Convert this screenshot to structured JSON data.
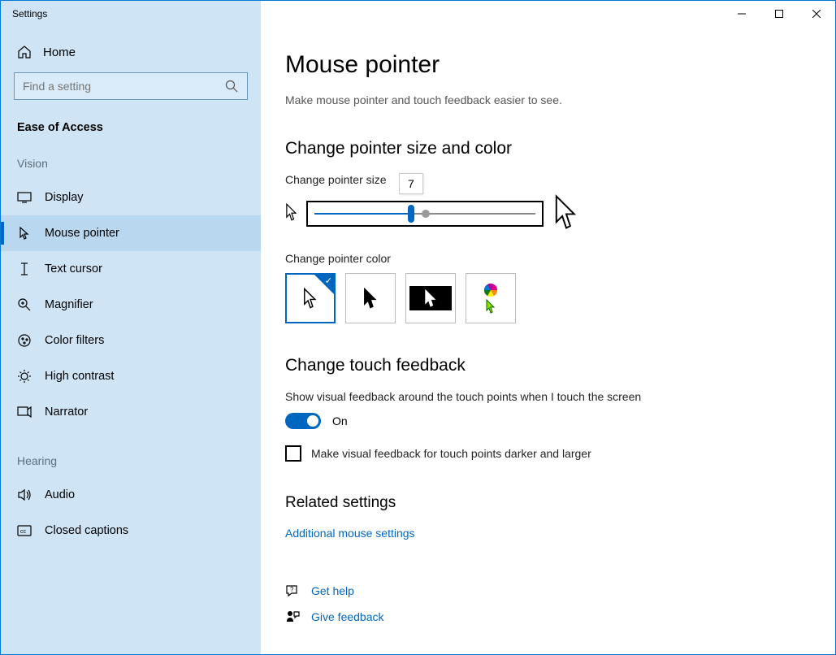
{
  "window": {
    "title": "Settings"
  },
  "sidebar": {
    "home": "Home",
    "search_placeholder": "Find a setting",
    "section": "Ease of Access",
    "groups": [
      {
        "label": "Vision",
        "items": [
          {
            "icon": "display-icon",
            "label": "Display"
          },
          {
            "icon": "mouse-pointer-icon",
            "label": "Mouse pointer",
            "active": true
          },
          {
            "icon": "text-cursor-icon",
            "label": "Text cursor"
          },
          {
            "icon": "magnifier-icon",
            "label": "Magnifier"
          },
          {
            "icon": "color-filters-icon",
            "label": "Color filters"
          },
          {
            "icon": "high-contrast-icon",
            "label": "High contrast"
          },
          {
            "icon": "narrator-icon",
            "label": "Narrator"
          }
        ]
      },
      {
        "label": "Hearing",
        "items": [
          {
            "icon": "audio-icon",
            "label": "Audio"
          },
          {
            "icon": "closed-captions-icon",
            "label": "Closed captions"
          }
        ]
      }
    ]
  },
  "page": {
    "title": "Mouse pointer",
    "subtitle": "Make mouse pointer and touch feedback easier to see.",
    "size_section": {
      "heading": "Change pointer size and color",
      "size_label": "Change pointer size",
      "size_value": "7",
      "color_label": "Change pointer color"
    },
    "touch_section": {
      "heading": "Change touch feedback",
      "desc": "Show visual feedback around the touch points when I touch the screen",
      "toggle_state": "On",
      "checkbox_label": "Make visual feedback for touch points darker and larger"
    },
    "related": {
      "heading": "Related settings",
      "link": "Additional mouse settings"
    },
    "help": {
      "get_help": "Get help",
      "give_feedback": "Give feedback"
    }
  }
}
